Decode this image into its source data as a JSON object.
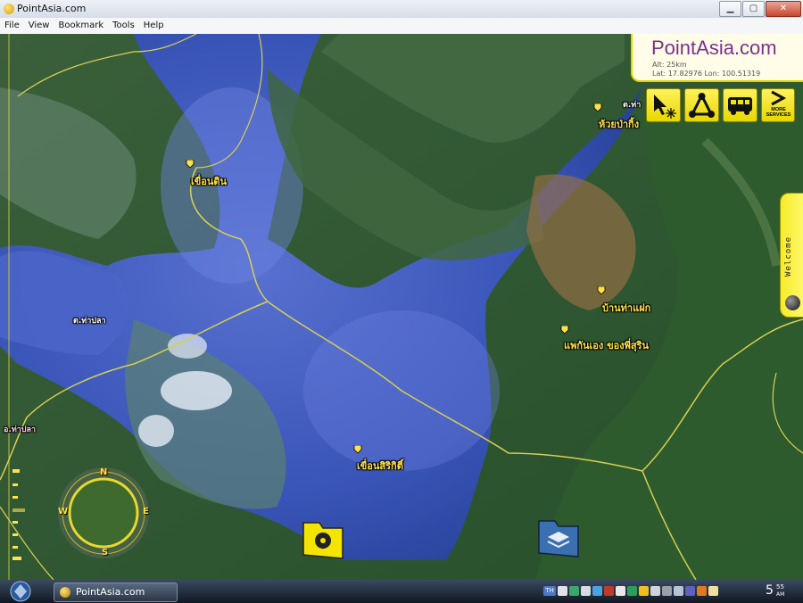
{
  "window": {
    "title": "PointAsia.com"
  },
  "window_controls": {
    "minimize": "▁",
    "maximize": "▢",
    "close": "✕"
  },
  "menu": [
    "File",
    "View",
    "Bookmark",
    "Tools",
    "Help"
  ],
  "brand_panel": {
    "brand": "PointAsia.com",
    "altitude": "Alt: 25km",
    "coordinates": "Lat: 17.82976 Lon: 100.51319"
  },
  "toolbar": {
    "more_services": "MORE SERVICES",
    "buttons": [
      "cursor-tool-icon",
      "network-icon",
      "bus-icon",
      "more-services-icon"
    ]
  },
  "welcome_tab": {
    "label": "Welcome"
  },
  "compass": {
    "north": "N",
    "east": "E",
    "south": "S",
    "west": "W"
  },
  "map_labels": {
    "dam1": "เขื่อนดิน",
    "dam2": "เขื่อนสิริกิติ์",
    "tambon_thapla": "ต.ท่าปลา",
    "amphoe_thapla": "อ.ท่าปลา",
    "ban_thaefak": "บ้านท่าแฝก",
    "resort": "แพกันเอง ของพี่สุริน",
    "huai_pakling": "ห้วยป่ากิ้ง",
    "tambon_tha": "ต.ท่า"
  },
  "taskbar": {
    "task_label": "PointAsia.com",
    "clock_hour": "5",
    "clock_minute": "55",
    "clock_ampm": "AM",
    "tray_text": "TH"
  },
  "colors": {
    "label_yellow": "#ffe24a",
    "brand_purple": "#7c2f8d",
    "toolbar_yellow": "#f4e500",
    "water": "#3450b8",
    "forest": "#2f5a2a"
  }
}
